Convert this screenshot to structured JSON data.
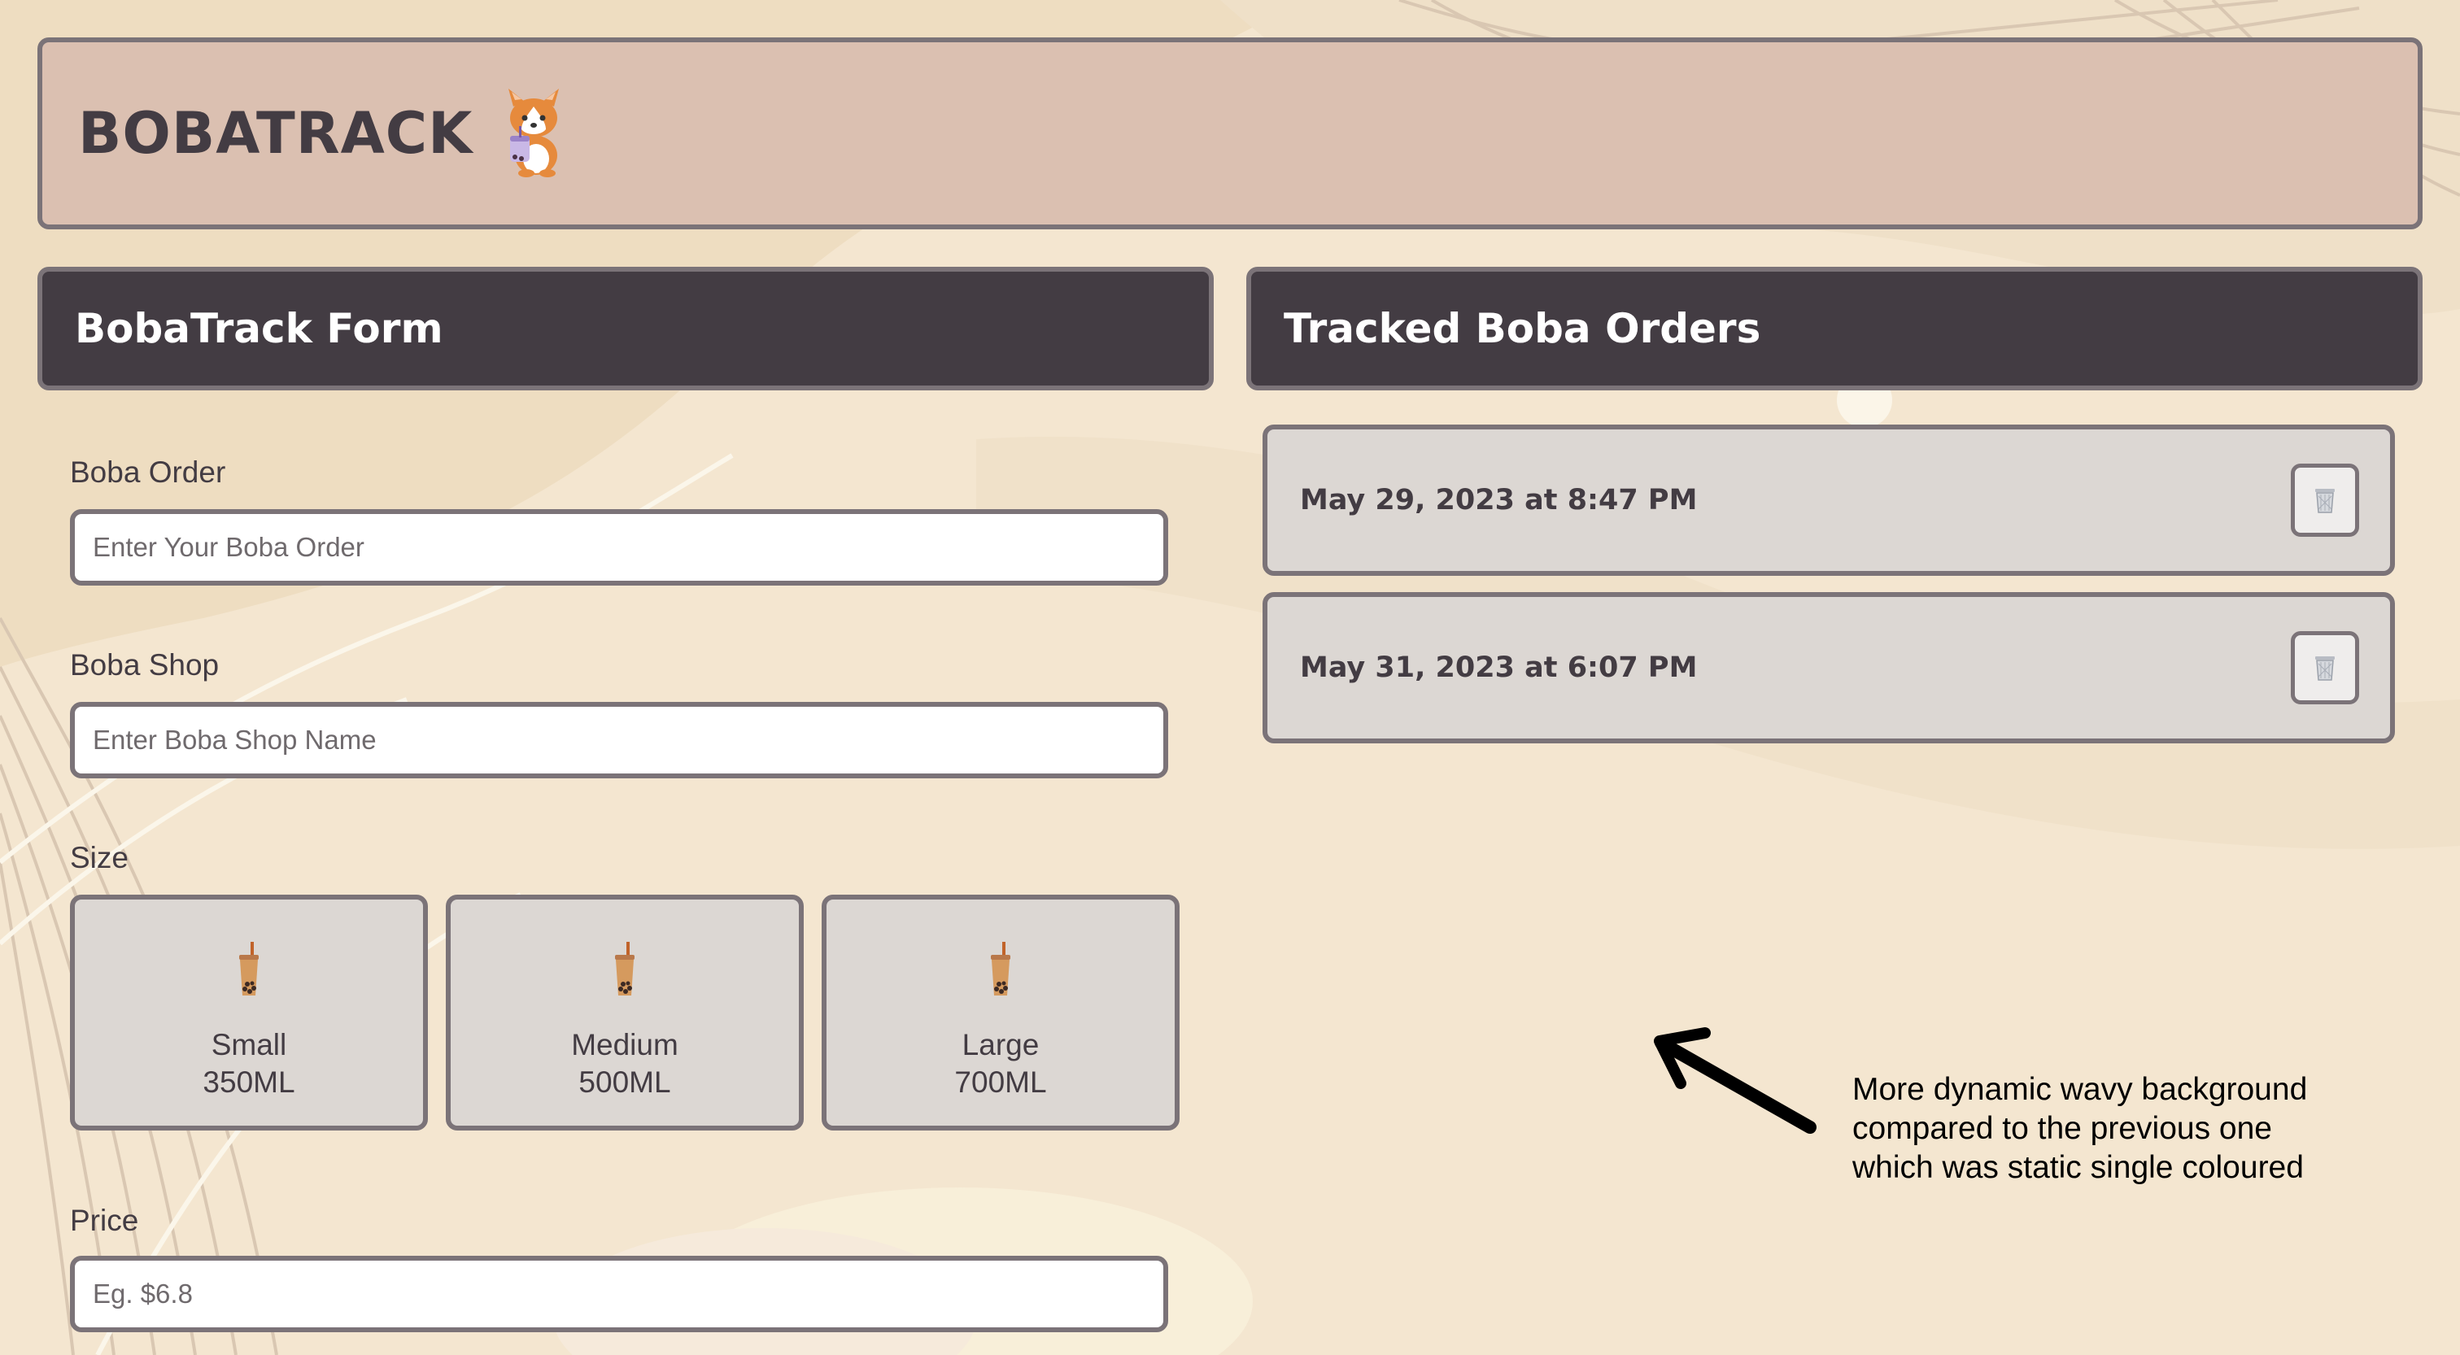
{
  "app": {
    "title": "BOBATRACK",
    "logo_icon": "corgi-with-boba-icon"
  },
  "form": {
    "heading": "BobaTrack Form",
    "order_label": "Boba Order",
    "order_placeholder": "Enter Your Boba Order",
    "shop_label": "Boba Shop",
    "shop_placeholder": "Enter Boba Shop Name",
    "size_label": "Size",
    "sizes": [
      {
        "name": "Small",
        "volume": "350ML",
        "icon": "boba-cup-icon"
      },
      {
        "name": "Medium",
        "volume": "500ML",
        "icon": "boba-cup-icon"
      },
      {
        "name": "Large",
        "volume": "700ML",
        "icon": "boba-cup-icon"
      }
    ],
    "price_label": "Price",
    "price_placeholder": "Eg. $6.8"
  },
  "orders": {
    "heading": "Tracked Boba Orders",
    "items": [
      {
        "date": "May 29, 2023 at 8:47 PM",
        "delete_icon": "trash-icon"
      },
      {
        "date": "May 31, 2023 at 6:07 PM",
        "delete_icon": "trash-icon"
      }
    ]
  },
  "annotation": {
    "text": "More dynamic wavy background compared to the previous one which was static single coloured",
    "icon": "arrow-icon"
  },
  "colors": {
    "background": "#f4e6d0",
    "header_bg": "#dbc0b1",
    "dark": "#433c43",
    "card_bg": "#dcd7d3",
    "border": "#7b7378"
  }
}
